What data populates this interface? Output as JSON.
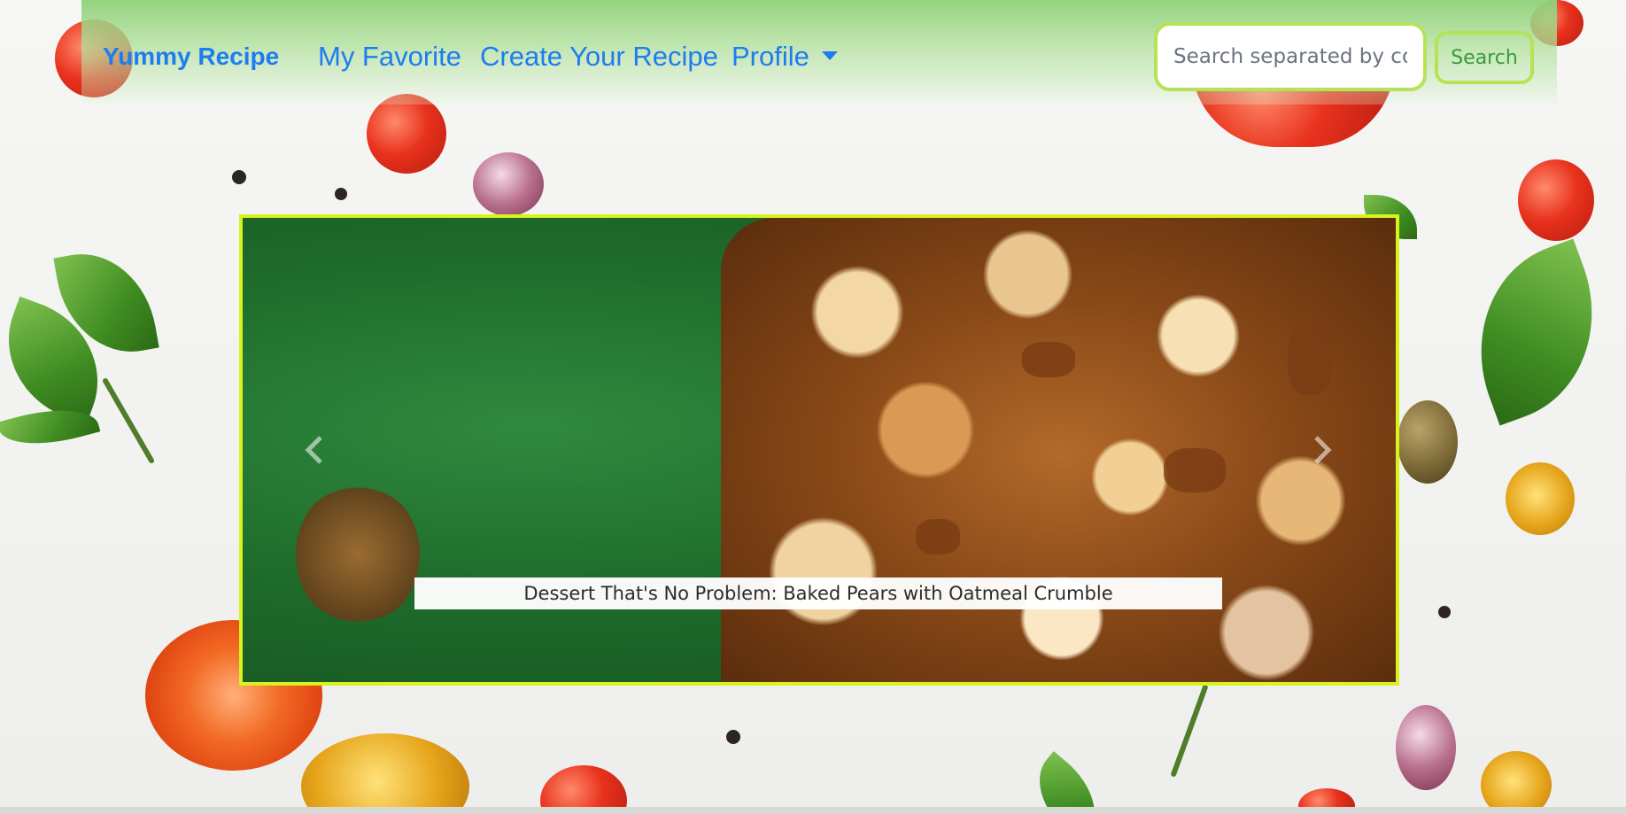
{
  "navbar": {
    "brand": "Yummy Recipe",
    "links": [
      {
        "label": "My Favorite"
      },
      {
        "label": "Create Your Recipe"
      },
      {
        "label": "Profile"
      }
    ],
    "search": {
      "placeholder": "Search separated by comma",
      "value": "",
      "button_label": "Search"
    }
  },
  "carousel": {
    "caption": "Dessert That's No Problem: Baked Pears with Oatmeal Crumble",
    "prev_icon": "chevron-left-icon",
    "next_icon": "chevron-right-icon"
  },
  "colors": {
    "link": "#1e7cf2",
    "accent_border": "#b5e355",
    "carousel_border": "#d7f21c",
    "search_button_text": "#3a9a3a"
  }
}
